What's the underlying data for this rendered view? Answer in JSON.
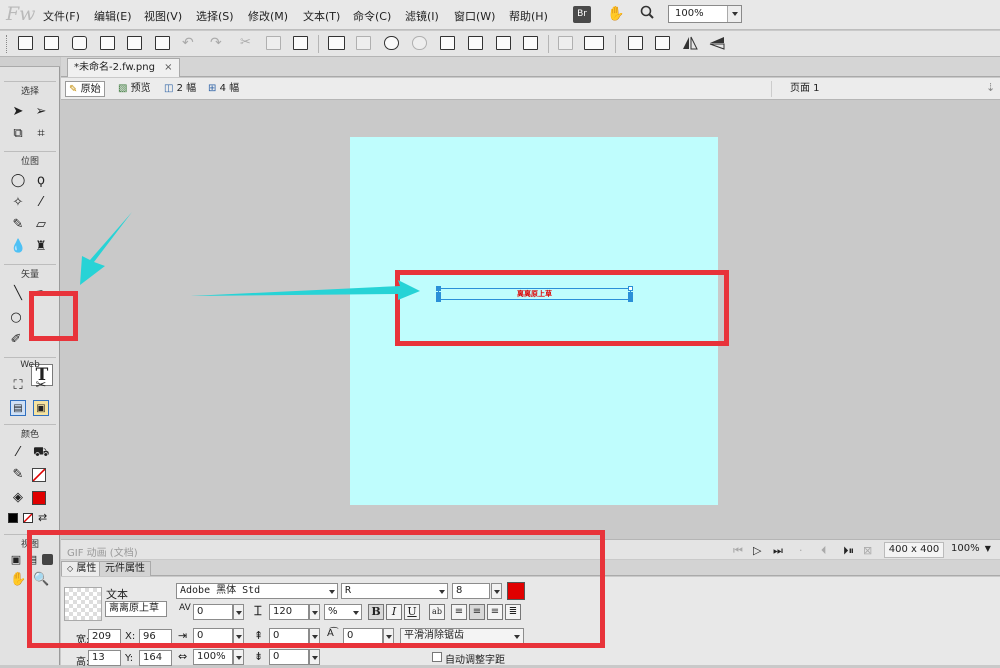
{
  "app": {
    "logo": "Fw"
  },
  "menu": [
    "文件(F)",
    "编辑(E)",
    "视图(V)",
    "选择(S)",
    "修改(M)",
    "文本(T)",
    "命令(C)",
    "滤镜(I)",
    "窗口(W)",
    "帮助(H)"
  ],
  "menubar": {
    "br_label": "Br",
    "zoom": "100%"
  },
  "document": {
    "tab_title": "*未命名-2.fw.png",
    "close_glyph": "×",
    "views": [
      "原始",
      "预览",
      "2 幅",
      "4 幅"
    ],
    "page": "页面 1"
  },
  "tools": {
    "sections": [
      "选择",
      "位图",
      "矢量",
      "Web",
      "颜色",
      "视图"
    ],
    "text_tool_glyph": "T",
    "fill_color": "#e00000"
  },
  "canvas": {
    "background": "#bffdfd",
    "text": "离离原上草",
    "text_color": "#e00000"
  },
  "status": {
    "gif_label": "GIF 动画 (文档)",
    "doc_size": "400 x 400",
    "zoom": "100%"
  },
  "properties": {
    "tabs": [
      "属性",
      "元件属性"
    ],
    "object_type": "文本",
    "object_name": "离离原上草",
    "font_family": "Adobe 黑体 Std",
    "font_style": "R",
    "font_size": "8",
    "color": "#e00000",
    "kerning": "0",
    "leading": "120",
    "leading_unit": "%",
    "format_buttons": [
      "B",
      "I",
      "U"
    ],
    "indent": "0",
    "space_before": "0",
    "baseline_shift": "0",
    "antialias": "平滑消除锯齿",
    "width_label": "宽:",
    "width": "209",
    "height_label": "高:",
    "height": "13",
    "x_label": "X:",
    "x": "96",
    "y_label": "Y:",
    "y": "164",
    "horizontal_scale": "100%",
    "space_after": "0",
    "auto_kern_label": "自动调整字距"
  }
}
